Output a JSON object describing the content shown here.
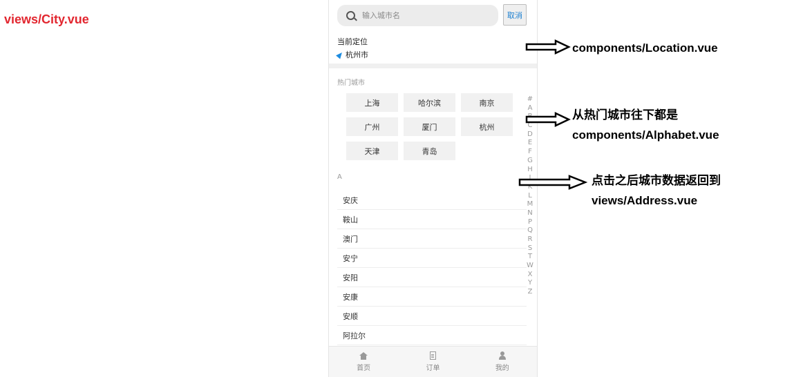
{
  "page_title": "views/City.vue",
  "search": {
    "placeholder": "输入城市名",
    "cancel_label": "取消"
  },
  "location": {
    "label": "当前定位",
    "city": "杭州市"
  },
  "hot": {
    "title": "热门城市",
    "cities": [
      "上海",
      "哈尔滨",
      "南京",
      "广州",
      "厦门",
      "杭州",
      "天津",
      "青岛"
    ]
  },
  "section_letter": "A",
  "city_list": [
    "安庆",
    "鞍山",
    "澳门",
    "安宁",
    "安阳",
    "安康",
    "安顺",
    "阿拉尔"
  ],
  "index_letters": [
    "#",
    "A",
    "B",
    "C",
    "D",
    "E",
    "F",
    "G",
    "H",
    "J",
    "K",
    "L",
    "M",
    "N",
    "P",
    "Q",
    "R",
    "S",
    "T",
    "W",
    "X",
    "Y",
    "Z"
  ],
  "tabs": [
    {
      "label": "首页",
      "icon": "home-icon"
    },
    {
      "label": "订单",
      "icon": "document-icon"
    },
    {
      "label": "我的",
      "icon": "user-icon"
    }
  ],
  "annotations": {
    "location": "components/Location.vue",
    "alphabet_line1": "从热门城市往下都是",
    "alphabet_line2": "components/Alphabet.vue",
    "address_line1": "点击之后城市数据返回到",
    "address_line2": "views/Address.vue"
  }
}
